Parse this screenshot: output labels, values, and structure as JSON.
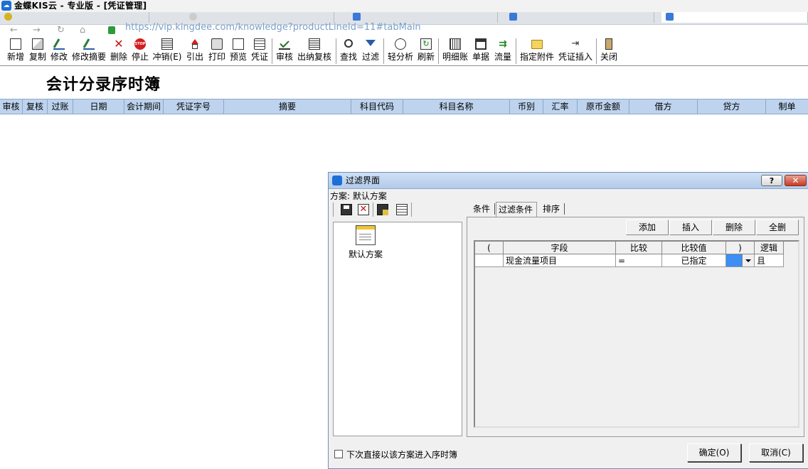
{
  "window": {
    "title": "金蝶KIS云 - 专业版 - [凭证管理]"
  },
  "browser": {
    "url": "https://vip.kingdee.com/knowledge?productLineId=11#tabMain"
  },
  "toolbar": {
    "items": [
      {
        "label": "新增",
        "icon": "new-doc-icon"
      },
      {
        "label": "复制",
        "icon": "copy-icon"
      },
      {
        "label": "修改",
        "icon": "edit-icon"
      },
      {
        "label": "修改摘要",
        "icon": "edit-summary-icon"
      },
      {
        "label": "删除",
        "icon": "delete-icon"
      },
      {
        "label": "停止",
        "icon": "stop-icon"
      },
      {
        "label": "冲销(E)",
        "icon": "reverse-icon"
      },
      {
        "label": "引出",
        "icon": "export-icon"
      },
      {
        "label": "打印",
        "icon": "print-icon"
      },
      {
        "label": "预览",
        "icon": "preview-icon"
      },
      {
        "label": "凭证",
        "icon": "voucher-icon"
      },
      {
        "label": "审核",
        "icon": "audit-icon"
      },
      {
        "label": "出纳复核",
        "icon": "cashier-review-icon"
      },
      {
        "label": "查找",
        "icon": "find-icon"
      },
      {
        "label": "过滤",
        "icon": "filter-icon"
      },
      {
        "label": "轻分析",
        "icon": "light-analysis-icon"
      },
      {
        "label": "刷新",
        "icon": "refresh-icon"
      },
      {
        "label": "明细账",
        "icon": "ledger-icon"
      },
      {
        "label": "单据",
        "icon": "document-icon"
      },
      {
        "label": "流量",
        "icon": "flow-icon"
      },
      {
        "label": "指定附件",
        "icon": "attachment-icon"
      },
      {
        "label": "凭证插入",
        "icon": "insert-voucher-icon"
      },
      {
        "label": "关闭",
        "icon": "exit-icon"
      }
    ]
  },
  "report": {
    "title": "会计分录序时簿",
    "columns": [
      "审核",
      "复核",
      "过账",
      "日期",
      "会计期间",
      "凭证字号",
      "摘要",
      "科目代码",
      "科目名称",
      "币别",
      "汇率",
      "原币金额",
      "借方",
      "贷方",
      "制单"
    ]
  },
  "dialog": {
    "title": "过滤界面",
    "scheme_label": "方案: 默认方案",
    "scheme_item": "默认方案",
    "tabs": [
      "条件",
      "过滤条件",
      "排序"
    ],
    "selected_tab": "过滤条件",
    "actions": [
      "添加",
      "插入",
      "删除",
      "全删"
    ],
    "grid": {
      "headers": [
        "(",
        "字段",
        "比较",
        "比较值",
        ")",
        "逻辑"
      ],
      "rows": [
        {
          "paren_open": "",
          "field": "现金流量项目",
          "compare": "=",
          "value": "已指定",
          "paren_close": "",
          "logic": "且"
        }
      ]
    },
    "checkbox_label": "下次直接以该方案进入序时簿",
    "ok_label": "确定(O)",
    "cancel_label": "取消(C)",
    "help_label": "?",
    "close_label": "✕"
  },
  "colors": {
    "header_bg": "#bdd3ee",
    "title_bar_bg": "#cfe0f5",
    "selection_blue": "#3d8ef5"
  }
}
